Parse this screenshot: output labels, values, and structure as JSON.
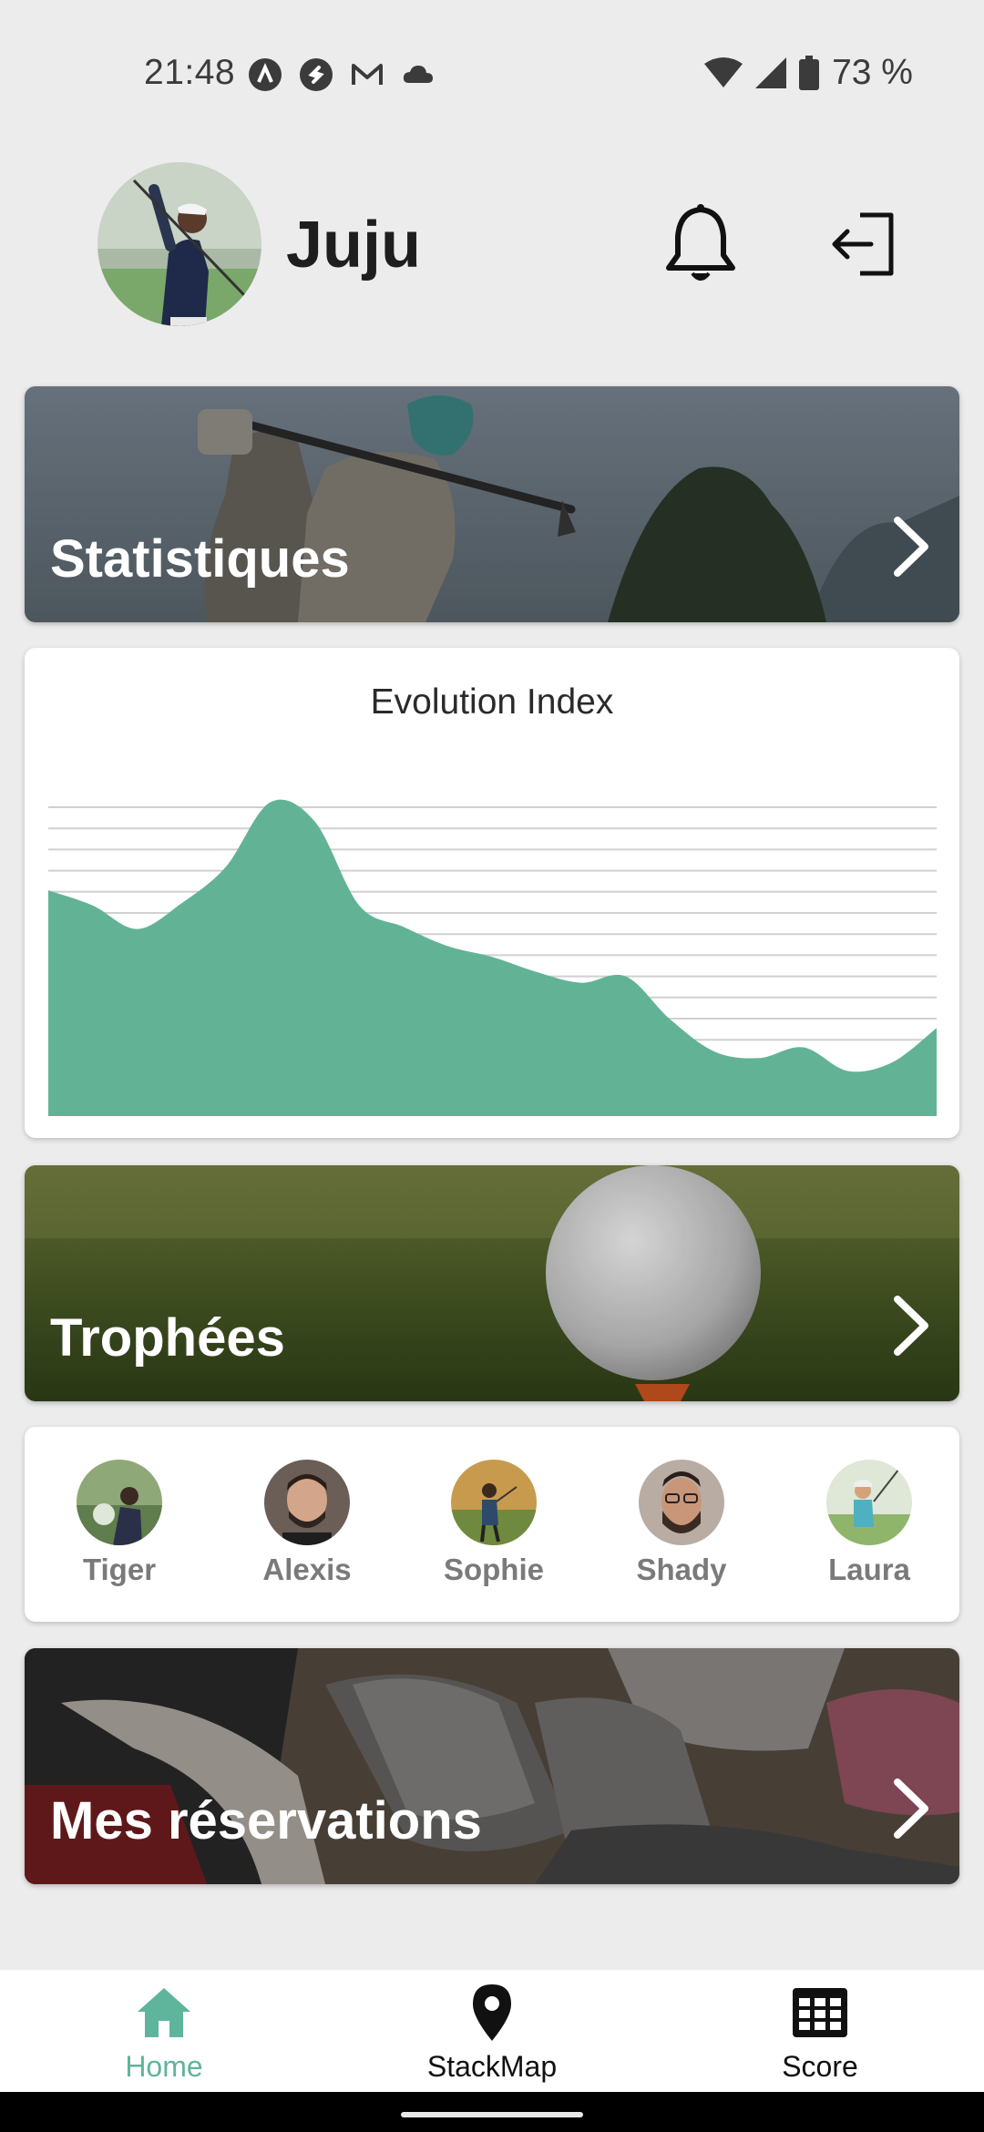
{
  "status_bar": {
    "time": "21:48",
    "battery_percent": "73 %",
    "icons": [
      "a-circle-icon",
      "shazam-icon",
      "gmail-icon",
      "cloud-icon",
      "wifi-icon",
      "signal-icon",
      "battery-icon"
    ]
  },
  "header": {
    "username": "Juju",
    "icons": [
      "bell-icon",
      "logout-icon"
    ]
  },
  "cards": {
    "stats_label": "Statistiques",
    "trophies_label": "Trophées",
    "reservations_label": "Mes réservations"
  },
  "chart": {
    "title": "Evolution Index"
  },
  "chart_data": {
    "type": "area",
    "title": "Evolution Index",
    "x": [
      0,
      1,
      2,
      3,
      4,
      5,
      6,
      7,
      8,
      9,
      10,
      11,
      12,
      13,
      14,
      15,
      16,
      17,
      18,
      19,
      20
    ],
    "values": [
      10.5,
      9.8,
      8.7,
      9.9,
      11.6,
      14.6,
      13.7,
      9.8,
      8.8,
      7.9,
      7.4,
      6.7,
      6.2,
      6.5,
      4.5,
      3.0,
      2.7,
      3.2,
      2.1,
      2.5,
      4.1
    ],
    "ylim": [
      0,
      15
    ],
    "grid": true,
    "fill_color": "#62b395",
    "grid_color": "#d0d0d0"
  },
  "friends": [
    {
      "name": "Tiger",
      "avatar_color": "#6f8f5a"
    },
    {
      "name": "Alexis",
      "avatar_color": "#7a6a5e"
    },
    {
      "name": "Sophie",
      "avatar_color": "#a89050"
    },
    {
      "name": "Shady",
      "avatar_color": "#8a7d74"
    },
    {
      "name": "Laura",
      "avatar_color": "#9fbf7a"
    }
  ],
  "bottom_nav": {
    "home_label": "Home",
    "stackmap_label": "StackMap",
    "score_label": "Score",
    "active": "Home",
    "accent_color": "#5fb49c"
  }
}
